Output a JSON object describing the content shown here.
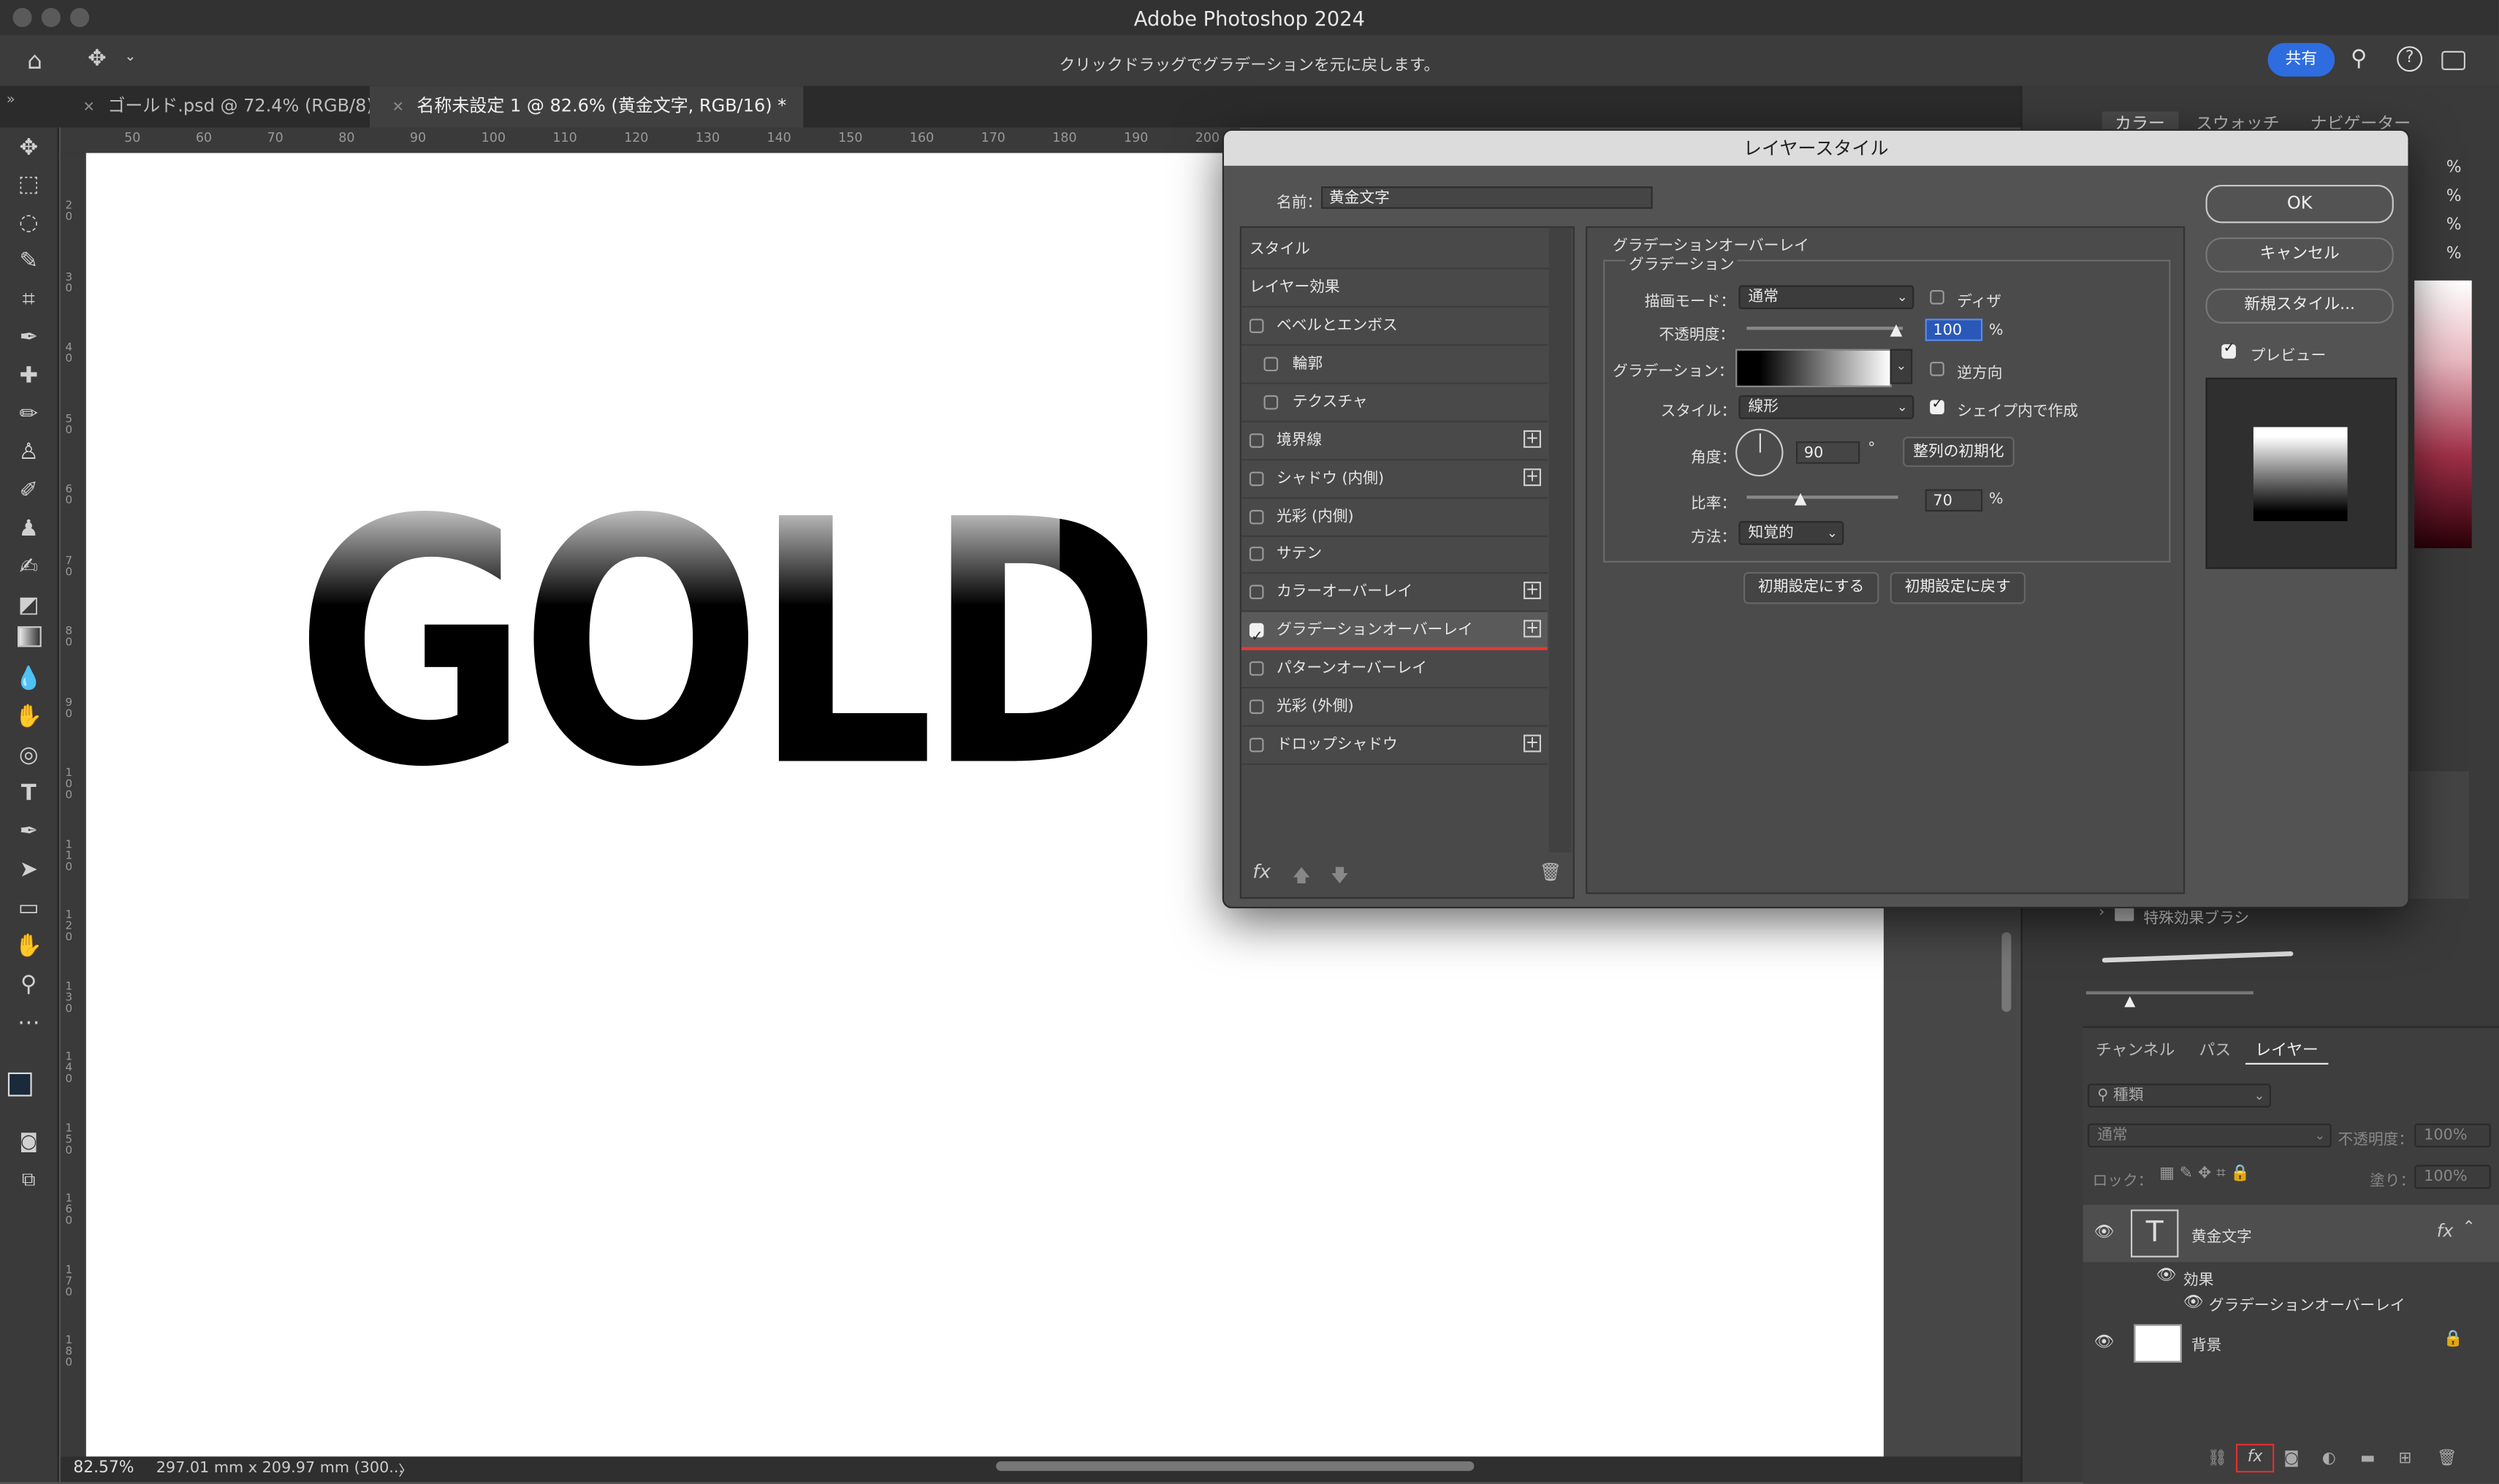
{
  "app": {
    "title": "Adobe Photoshop 2024",
    "hint": "クリックドラッグでグラデーションを元に戻します。",
    "share_label": "共有"
  },
  "tabs": [
    {
      "label": "ゴールド.psd @ 72.4% (RGB/8) *"
    },
    {
      "label": "名称未設定 1 @ 82.6% (黄金文字, RGB/16) *"
    }
  ],
  "ruler": {
    "top": [
      "50",
      "60",
      "70",
      "80",
      "90",
      "100",
      "110",
      "120",
      "130",
      "140",
      "150",
      "160",
      "170",
      "180",
      "190",
      "200"
    ],
    "left": [
      "2 0",
      "3 0",
      "4 0",
      "5 0",
      "6 0",
      "7 0",
      "8 0",
      "9 0",
      "1 0 0",
      "1 1 0",
      "1 2 0",
      "1 3 0",
      "1 4 0",
      "1 5 0",
      "1 6 0",
      "1 7 0",
      "1 8 0"
    ]
  },
  "canvas": {
    "text": "GOLD"
  },
  "status": {
    "zoom": "82.57%",
    "size": "297.01 mm x 209.97 mm (300...",
    "chevron": "〉"
  },
  "dialog": {
    "title": "レイヤースタイル",
    "name_label": "名前：",
    "name_value": "黄金文字",
    "ok": "OK",
    "cancel": "キャンセル",
    "new_style": "新規スタイル...",
    "preview_label": "プレビュー",
    "styles_header": "スタイル",
    "effects_header": "レイヤー効果",
    "effects": [
      {
        "label": "ベベルとエンボス",
        "checked": false,
        "plus": false,
        "indent": false
      },
      {
        "label": "輪郭",
        "checked": false,
        "plus": false,
        "indent": true
      },
      {
        "label": "テクスチャ",
        "checked": false,
        "plus": false,
        "indent": true
      },
      {
        "label": "境界線",
        "checked": false,
        "plus": true,
        "indent": false
      },
      {
        "label": "シャドウ (内側)",
        "checked": false,
        "plus": true,
        "indent": false
      },
      {
        "label": "光彩 (内側)",
        "checked": false,
        "plus": false,
        "indent": false
      },
      {
        "label": "サテン",
        "checked": false,
        "plus": false,
        "indent": false
      },
      {
        "label": "カラーオーバーレイ",
        "checked": false,
        "plus": true,
        "indent": false
      },
      {
        "label": "グラデーションオーバーレイ",
        "checked": true,
        "plus": true,
        "indent": false
      },
      {
        "label": "パターンオーバーレイ",
        "checked": false,
        "plus": false,
        "indent": false
      },
      {
        "label": "光彩 (外側)",
        "checked": false,
        "plus": false,
        "indent": false
      },
      {
        "label": "ドロップシャドウ",
        "checked": false,
        "plus": true,
        "indent": false
      }
    ],
    "fx_label": "fx",
    "section_title": "グラデーションオーバーレイ",
    "subsection_title": "グラデーション",
    "blend_mode_label": "描画モード：",
    "blend_mode_value": "通常",
    "dither_label": "ディザ",
    "opacity_label": "不透明度：",
    "opacity_value": "100",
    "percent": "%",
    "gradient_label": "グラデーション：",
    "reverse_label": "逆方向",
    "style_label": "スタイル：",
    "style_value": "線形",
    "align_shape_label": "シェイプ内で作成",
    "angle_label": "角度：",
    "angle_value": "90",
    "degree": "°",
    "reset_align": "整列の初期化",
    "scale_label": "比率：",
    "scale_value": "70",
    "method_label": "方法：",
    "method_value": "知覚的",
    "make_default": "初期設定にする",
    "reset_default": "初期設定に戻す"
  },
  "right_panel": {
    "color_tabs": [
      "カラー",
      "スウォッチ",
      "ナビゲーター"
    ],
    "percents": [
      "%",
      "%",
      "%",
      "%"
    ],
    "brush_folder": "特殊効果ブラシ",
    "layer_tabs": [
      "チャンネル",
      "パス",
      "レイヤー"
    ],
    "filter_placeholder": "種類",
    "blend_value": "通常",
    "opacity_label": "不透明度：",
    "opacity_value": "100%",
    "lock_label": "ロック：",
    "fill_label": "塗り：",
    "fill_value": "100%",
    "layers": [
      {
        "name": "黄金文字",
        "type": "text"
      },
      {
        "name": "背景",
        "type": "background"
      }
    ],
    "effects_label": "効果",
    "effect_item": "グラデーションオーバーレイ"
  }
}
